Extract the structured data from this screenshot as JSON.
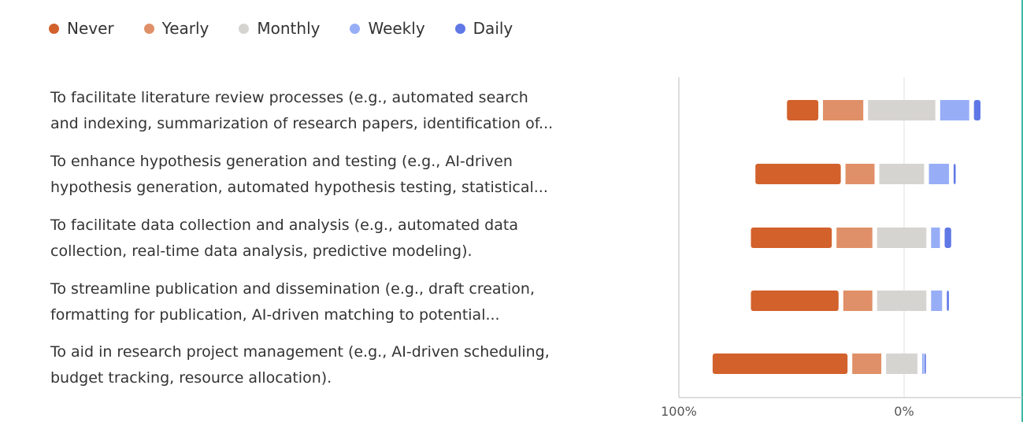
{
  "chart_data": {
    "type": "bar",
    "orientation": "horizontal",
    "stacked": "diverging",
    "title": "",
    "legend_position": "top-left",
    "grid": false,
    "series": [
      {
        "name": "Never",
        "color": "#d2612c"
      },
      {
        "name": "Yearly",
        "color": "#e09068"
      },
      {
        "name": "Monthly",
        "color": "#d6d4d1"
      },
      {
        "name": "Weekly",
        "color": "#97aef7"
      },
      {
        "name": "Daily",
        "color": "#5f78e6"
      }
    ],
    "categories": [
      {
        "lines": [
          "To facilitate literature review processes (e.g., automated search",
          "and indexing, summarization of research papers, identification of..."
        ],
        "values": [
          16,
          20,
          32,
          15,
          5
        ]
      },
      {
        "lines": [
          "To enhance hypothesis generation and testing (e.g., AI-driven",
          "hypothesis generation, automated hypothesis testing, statistical..."
        ],
        "values": [
          40,
          15,
          22,
          11,
          3
        ]
      },
      {
        "lines": [
          "To facilitate data collection and analysis (e.g., automated data",
          "collection, real-time data analysis, predictive modeling)."
        ],
        "values": [
          38,
          18,
          24,
          6,
          5
        ]
      },
      {
        "lines": [
          "To streamline publication and dissemination (e.g., draft creation,",
          "formatting for publication, AI-driven matching to potential..."
        ],
        "values": [
          41,
          15,
          24,
          7,
          3
        ]
      },
      {
        "lines": [
          "To aid in research project management (e.g., AI-driven scheduling,",
          "budget tracking, resource allocation)."
        ],
        "values": [
          62,
          15,
          16,
          1,
          1.5
        ]
      }
    ],
    "x_ticks": [
      "100%",
      "0%"
    ],
    "xlim": [
      -100,
      50
    ]
  }
}
